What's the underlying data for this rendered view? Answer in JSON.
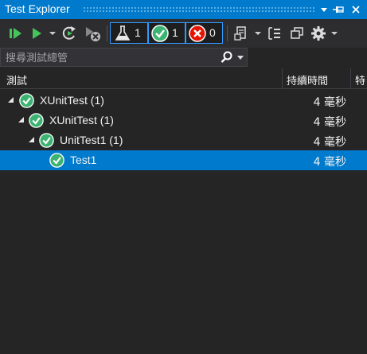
{
  "window": {
    "title": "Test Explorer"
  },
  "colors": {
    "accent": "#007acc",
    "pass": "#3cb371",
    "fail": "#e51400",
    "background": "#252526"
  },
  "toolbar": {
    "run_all_icon": "run-all-icon",
    "run_icon": "run-icon",
    "counters": {
      "total": "1",
      "passed": "1",
      "failed": "0"
    }
  },
  "search": {
    "placeholder": "搜尋測試總管"
  },
  "columns": {
    "test": "測試",
    "duration": "持續時間",
    "traits": "特"
  },
  "tree": [
    {
      "label": "XUnitTest (1)",
      "duration": "4 毫秒",
      "status": "passed"
    },
    {
      "label": "XUnitTest (1)",
      "duration": "4 毫秒",
      "status": "passed"
    },
    {
      "label": "UnitTest1 (1)",
      "duration": "4 毫秒",
      "status": "passed"
    },
    {
      "label": "Test1",
      "duration": "4 毫秒",
      "status": "passed",
      "selected": true
    }
  ]
}
